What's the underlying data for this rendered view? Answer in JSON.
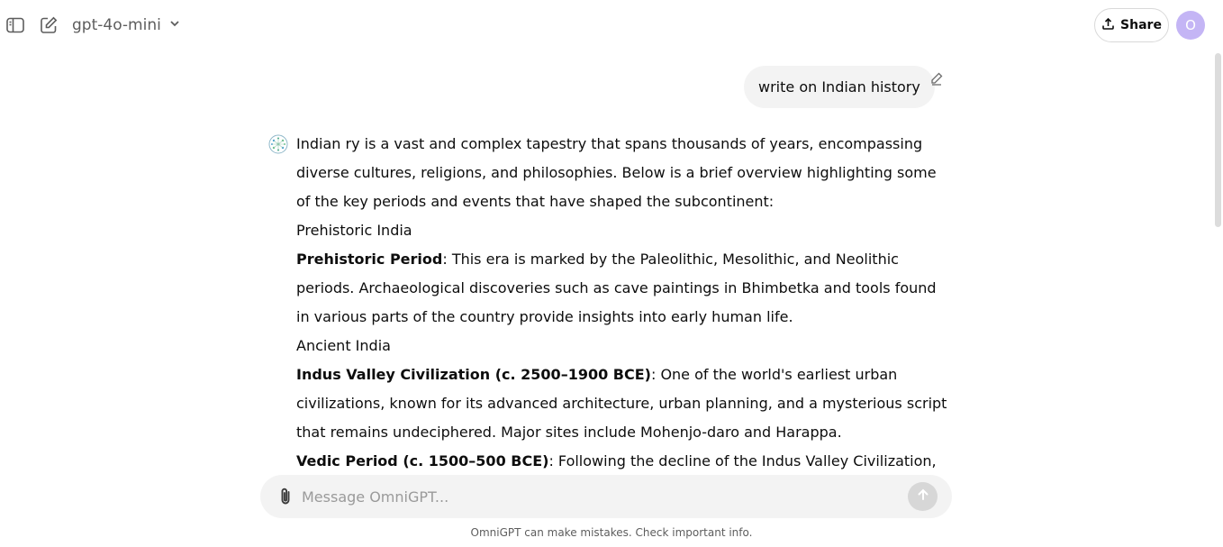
{
  "header": {
    "model_name": "gpt-4o-mini",
    "share_label": "Share",
    "avatar_initial": "O",
    "icons": [
      "sidebar-toggle-icon",
      "new-chat-icon",
      "chevron-down-icon",
      "upload-icon"
    ]
  },
  "conversation": {
    "user_message": "write on Indian history",
    "response": {
      "intro": "Indian ry is a vast and complex tapestry that spans thousands of years, encompassing diverse cultures, religions, and philosophies. Below is a brief overview highlighting some of the key periods and events that have shaped the subcontinent:",
      "sections": [
        {
          "heading": "Prehistoric India",
          "items": [
            {
              "term": "Prehistoric Period",
              "text": ": This era is marked by the Paleolithic, Mesolithic, and Neolithic periods. Archaeological discoveries such as cave paintings in Bhimbetka and tools found in various parts of the country provide insights into early human life."
            }
          ]
        },
        {
          "heading": "Ancient India",
          "items": [
            {
              "term": "Indus Valley Civilization (c. 2500–1900 BCE)",
              "text": ": One of the world's earliest urban civilizations, known for its advanced architecture, urban planning, and a mysterious script that remains undeciphered. Major sites include Mohenjo-daro and Harappa."
            },
            {
              "term": "Vedic Period (c. 1500–500 BCE)",
              "text": ": Following the decline of the Indus Valley Civilization, the Vedic"
            }
          ]
        }
      ]
    }
  },
  "composer": {
    "placeholder": "Message OmniGPT..."
  },
  "footer": {
    "disclaimer": "OmniGPT can make mistakes. Check important info."
  },
  "colors": {
    "accent_avatar": "#c4b5f5",
    "bubble_bg": "#f3f3f3",
    "send_button": "#d7d7d7"
  }
}
